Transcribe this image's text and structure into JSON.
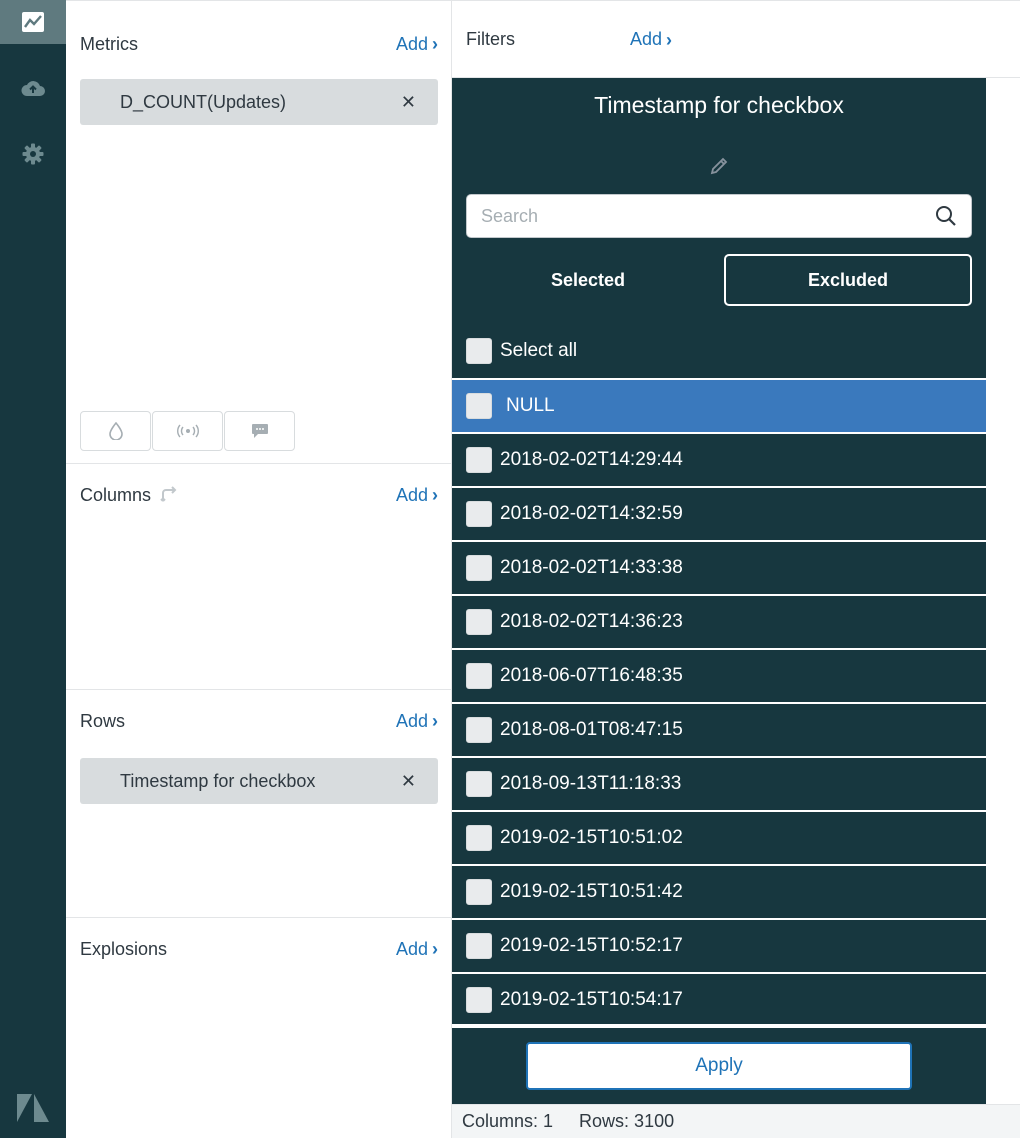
{
  "nav": {
    "items": [
      {
        "icon": "chart-icon",
        "active": true
      },
      {
        "icon": "cloud-upload-icon",
        "active": false
      },
      {
        "icon": "gear-icon",
        "active": false
      }
    ],
    "logo": "zendesk-logo-icon"
  },
  "config": {
    "metrics": {
      "title": "Metrics",
      "add_label": "Add",
      "pill_label": "D_COUNT(Updates)"
    },
    "columns": {
      "title": "Columns",
      "add_label": "Add"
    },
    "rows": {
      "title": "Rows",
      "add_label": "Add",
      "pill_label": "Timestamp for checkbox"
    },
    "explosions": {
      "title": "Explosions",
      "add_label": "Add"
    }
  },
  "filters": {
    "title": "Filters",
    "add_label": "Add"
  },
  "panel": {
    "title": "Timestamp for checkbox",
    "search_placeholder": "Search",
    "toggle_selected": "Selected",
    "toggle_excluded": "Excluded",
    "select_all": "Select all",
    "values": [
      "NULL",
      "2018-02-02T14:29:44",
      "2018-02-02T14:32:59",
      "2018-02-02T14:33:38",
      "2018-02-02T14:36:23",
      "2018-06-07T16:48:35",
      "2018-08-01T08:47:15",
      "2018-09-13T11:18:33",
      "2019-02-15T10:51:02",
      "2019-02-15T10:51:42",
      "2019-02-15T10:52:17",
      "2019-02-15T10:54:17"
    ],
    "highlighted_value": "NULL",
    "apply_label": "Apply"
  },
  "status": {
    "columns": "Columns: 1",
    "rows": "Rows: 3100"
  },
  "colors": {
    "dark_teal": "#17373f",
    "highlight_blue": "#3a79bd",
    "link_blue": "#1f73b7",
    "pill_grey": "#d8dcde"
  }
}
